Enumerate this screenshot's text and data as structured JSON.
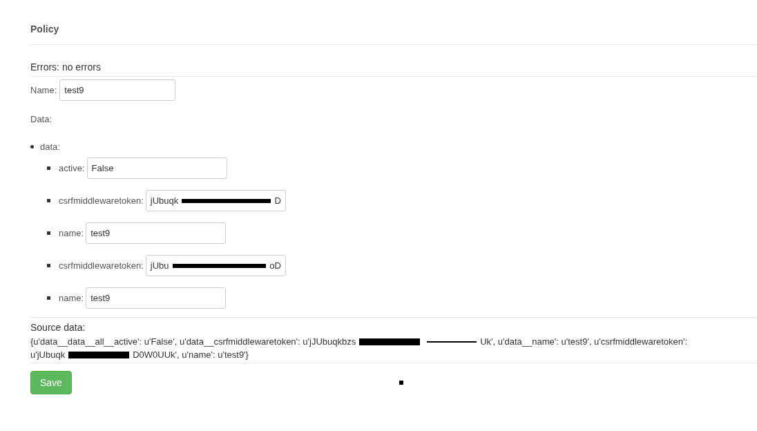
{
  "title": "Policy",
  "errors": "Errors: no errors",
  "name_field": {
    "label": "Name:",
    "value": "test9"
  },
  "data_label": "Data:",
  "data_tree": {
    "label": "data:",
    "children": [
      {
        "kind": "plain",
        "label": "active:",
        "value": "False"
      },
      {
        "kind": "redacted",
        "label": "csrfmiddlewaretoken:",
        "prefix": "jUbuqk",
        "suffix": "D"
      },
      {
        "kind": "plain",
        "label": "name:",
        "value": "test9"
      },
      {
        "kind": "redacted",
        "label": "csrfmiddlewaretoken:",
        "prefix": "jUbu",
        "suffix": "oD"
      },
      {
        "kind": "plain",
        "label": "name:",
        "value": "test9"
      }
    ]
  },
  "source": {
    "label": "Source data:",
    "lines": [
      [
        {
          "kind": "text",
          "text": "{u'data__data__all__active': u'False', u'data__csrfmiddlewaretoken': u'jJUbuqkbzs"
        },
        {
          "kind": "redaction"
        },
        {
          "kind": "line"
        },
        {
          "kind": "text",
          "text": "Uk', u'data__name': u'test9', u'csrfmiddlewaretoken':"
        }
      ],
      [
        {
          "kind": "text",
          "text": "u'jUbuqk"
        },
        {
          "kind": "redaction"
        },
        {
          "kind": "text",
          "text": "D0W0UUk', u'name': u'test9'}"
        }
      ]
    ]
  },
  "save_button": "Save"
}
